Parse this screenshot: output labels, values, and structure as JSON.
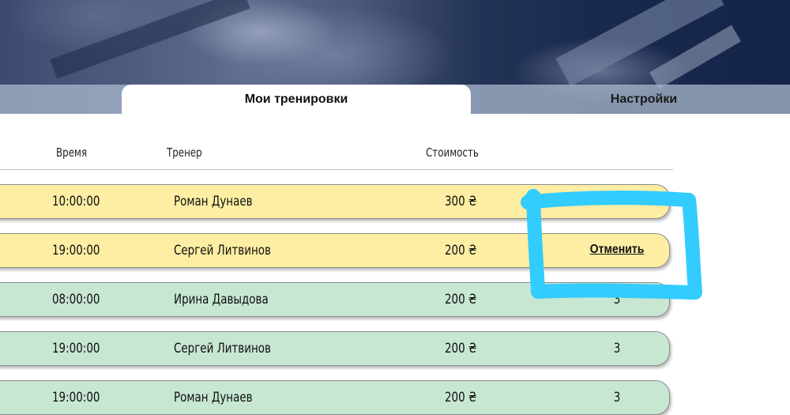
{
  "tabs": {
    "active_label": "Мои тренировки",
    "inactive_label": "Настройки"
  },
  "table": {
    "headers": {
      "time": "Время",
      "trainer": "Тренер",
      "price": "Стоимость"
    },
    "rows": [
      {
        "time": "10:00:00",
        "trainer": "Роман Дунаев",
        "price": "300 ₴",
        "action": "",
        "status": "upcoming"
      },
      {
        "time": "19:00:00",
        "trainer": "Сергей Литвинов",
        "price": "200 ₴",
        "action": "Отменить",
        "status": "upcoming"
      },
      {
        "time": "08:00:00",
        "trainer": "Ирина Давыдова",
        "price": "200 ₴",
        "action": "3",
        "status": "past"
      },
      {
        "time": "19:00:00",
        "trainer": "Сергей Литвинов",
        "price": "200 ₴",
        "action": "3",
        "status": "past"
      },
      {
        "time": "19:00:00",
        "trainer": "Роман Дунаев",
        "price": "200 ₴",
        "action": "3",
        "status": "past"
      }
    ]
  },
  "colors": {
    "row_upcoming": "#fdeea3",
    "row_past": "#c7e7d3",
    "annotation": "#33ccff"
  }
}
